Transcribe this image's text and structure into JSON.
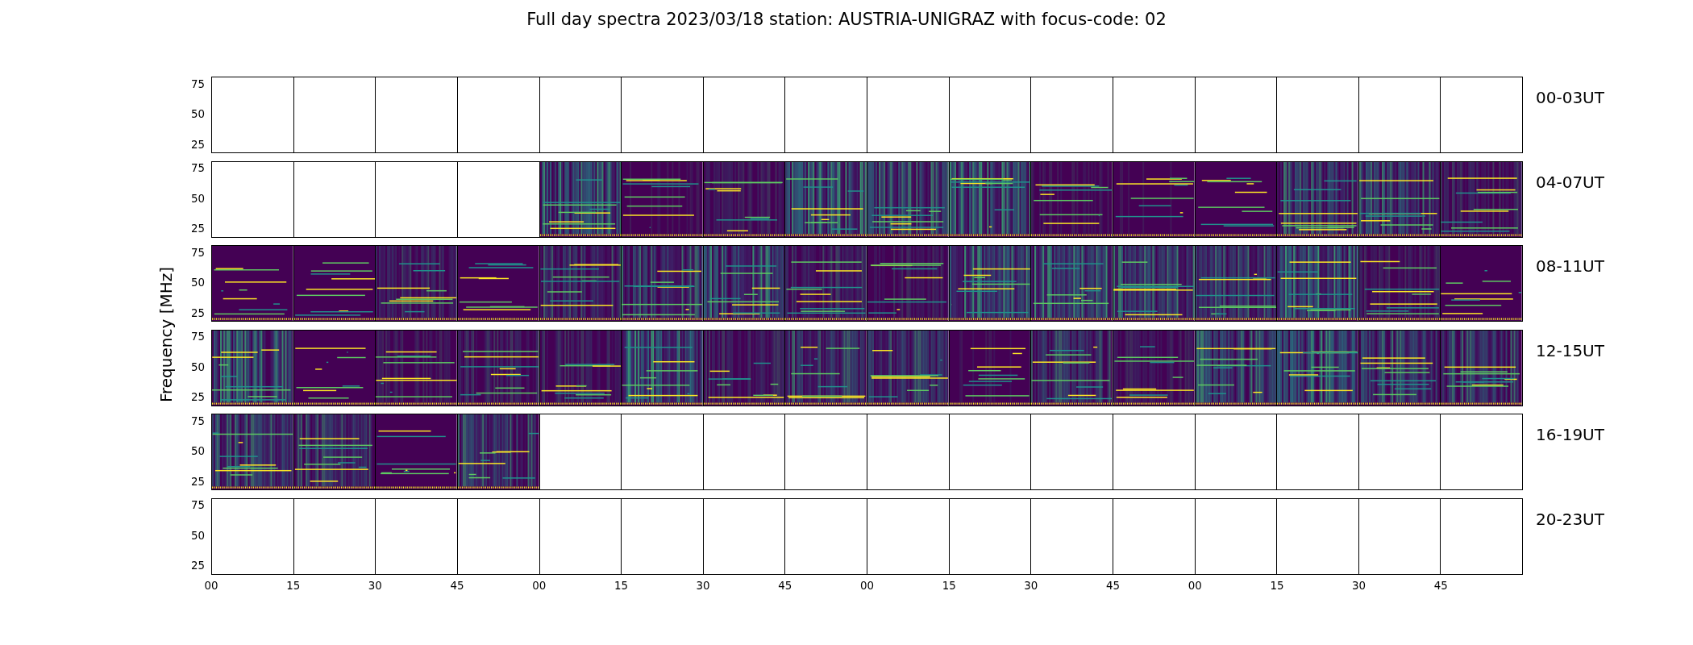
{
  "title": "Full day spectra 2023/03/18 station: AUSTRIA-UNIGRAZ with focus-code: 02",
  "y_axis_label": "Frequency [MHz]",
  "rows": [
    {
      "label": "00-03UT",
      "y_ticks": [
        "75",
        "50",
        "25"
      ],
      "cells": [
        {
          "has_data": false
        },
        {
          "has_data": false
        },
        {
          "has_data": false
        },
        {
          "has_data": false
        },
        {
          "has_data": false
        },
        {
          "has_data": false
        },
        {
          "has_data": false
        },
        {
          "has_data": false
        },
        {
          "has_data": false
        },
        {
          "has_data": false
        },
        {
          "has_data": false
        },
        {
          "has_data": false
        },
        {
          "has_data": false
        },
        {
          "has_data": false
        },
        {
          "has_data": false
        },
        {
          "has_data": false
        }
      ]
    },
    {
      "label": "04-07UT",
      "y_ticks": [
        "75",
        "50",
        "25"
      ],
      "cells": [
        {
          "has_data": false
        },
        {
          "has_data": false
        },
        {
          "has_data": false
        },
        {
          "has_data": false
        },
        {
          "has_data": true
        },
        {
          "has_data": true
        },
        {
          "has_data": true
        },
        {
          "has_data": true
        },
        {
          "has_data": true
        },
        {
          "has_data": true
        },
        {
          "has_data": true
        },
        {
          "has_data": true
        },
        {
          "has_data": true
        },
        {
          "has_data": true
        },
        {
          "has_data": true
        },
        {
          "has_data": true
        }
      ]
    },
    {
      "label": "08-11UT",
      "y_ticks": [
        "75",
        "50",
        "25"
      ],
      "cells": [
        {
          "has_data": true
        },
        {
          "has_data": true
        },
        {
          "has_data": true
        },
        {
          "has_data": true
        },
        {
          "has_data": true
        },
        {
          "has_data": true
        },
        {
          "has_data": true
        },
        {
          "has_data": true
        },
        {
          "has_data": true
        },
        {
          "has_data": true
        },
        {
          "has_data": true
        },
        {
          "has_data": true
        },
        {
          "has_data": true
        },
        {
          "has_data": true
        },
        {
          "has_data": true
        },
        {
          "has_data": true
        }
      ]
    },
    {
      "label": "12-15UT",
      "y_ticks": [
        "75",
        "50",
        "25"
      ],
      "cells": [
        {
          "has_data": true
        },
        {
          "has_data": true
        },
        {
          "has_data": true
        },
        {
          "has_data": true
        },
        {
          "has_data": true
        },
        {
          "has_data": true
        },
        {
          "has_data": true
        },
        {
          "has_data": true
        },
        {
          "has_data": true
        },
        {
          "has_data": true
        },
        {
          "has_data": true
        },
        {
          "has_data": true
        },
        {
          "has_data": true
        },
        {
          "has_data": true
        },
        {
          "has_data": true
        },
        {
          "has_data": true
        }
      ]
    },
    {
      "label": "16-19UT",
      "y_ticks": [
        "75",
        "50",
        "25"
      ],
      "cells": [
        {
          "has_data": true
        },
        {
          "has_data": true
        },
        {
          "has_data": true
        },
        {
          "has_data": true
        },
        {
          "has_data": false
        },
        {
          "has_data": false
        },
        {
          "has_data": false
        },
        {
          "has_data": false
        },
        {
          "has_data": false
        },
        {
          "has_data": false
        },
        {
          "has_data": false
        },
        {
          "has_data": false
        },
        {
          "has_data": false
        },
        {
          "has_data": false
        },
        {
          "has_data": false
        },
        {
          "has_data": false
        }
      ]
    },
    {
      "label": "20-23UT",
      "y_ticks": [
        "75",
        "50",
        "25"
      ],
      "cells": [
        {
          "has_data": false
        },
        {
          "has_data": false
        },
        {
          "has_data": false
        },
        {
          "has_data": false
        },
        {
          "has_data": false
        },
        {
          "has_data": false
        },
        {
          "has_data": false
        },
        {
          "has_data": false
        },
        {
          "has_data": false
        },
        {
          "has_data": false
        },
        {
          "has_data": false
        },
        {
          "has_data": false
        },
        {
          "has_data": false
        },
        {
          "has_data": false
        },
        {
          "has_data": false
        },
        {
          "has_data": false
        }
      ]
    }
  ],
  "x_ticks": [
    "00",
    "15",
    "30",
    "45",
    "00",
    "15",
    "30",
    "45",
    "00",
    "15",
    "30",
    "45",
    "00",
    "15",
    "30",
    "45"
  ]
}
